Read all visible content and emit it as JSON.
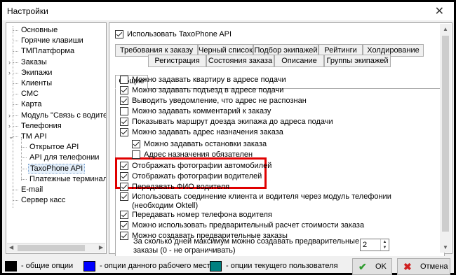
{
  "window": {
    "title": "Настройки",
    "close_glyph": "✕"
  },
  "tree": [
    {
      "label": "Основные",
      "level": 0,
      "expander": "",
      "selected": false
    },
    {
      "label": "Горячие клавиши",
      "level": 0,
      "expander": "",
      "selected": false
    },
    {
      "label": "ТМПлатформа",
      "level": 0,
      "expander": "",
      "selected": false
    },
    {
      "label": "Заказы",
      "level": 0,
      "expander": "›",
      "selected": false
    },
    {
      "label": "Экипажи",
      "level": 0,
      "expander": "›",
      "selected": false
    },
    {
      "label": "Клиенты",
      "level": 0,
      "expander": "",
      "selected": false
    },
    {
      "label": "СМС",
      "level": 0,
      "expander": "",
      "selected": false
    },
    {
      "label": "Карта",
      "level": 0,
      "expander": "",
      "selected": false
    },
    {
      "label": "Модуль \"Связь с водителе",
      "level": 0,
      "expander": "›",
      "selected": false
    },
    {
      "label": "Телефония",
      "level": 0,
      "expander": "›",
      "selected": false
    },
    {
      "label": "ТМ API",
      "level": 0,
      "expander": "⌄",
      "selected": false
    },
    {
      "label": "Открытое API",
      "level": 1,
      "expander": "",
      "selected": false
    },
    {
      "label": "API для телефонии",
      "level": 1,
      "expander": "",
      "selected": false
    },
    {
      "label": "TaxoPhone API",
      "level": 1,
      "expander": "",
      "selected": true
    },
    {
      "label": "Платежные терминалы",
      "level": 1,
      "expander": "",
      "selected": false
    },
    {
      "label": "E-mail",
      "level": 0,
      "expander": "",
      "selected": false
    },
    {
      "label": "Сервер касс",
      "level": 0,
      "expander": "",
      "selected": false
    }
  ],
  "use_api": {
    "label": "Использовать TaxoPhone API",
    "checked": true
  },
  "tabs_row1": [
    "Требования к заказу",
    "Черный список",
    "Подбор экипажей",
    "Рейтинги",
    "Холдирование"
  ],
  "tabs_row2": [
    "Общие",
    "Регистрация",
    "Состояния заказа",
    "Описание",
    "Группы экипажей"
  ],
  "active_tab": "Общие",
  "options": [
    {
      "label": "Можно задавать квартиру в адресе подачи",
      "checked": false,
      "indent": 0
    },
    {
      "label": "Можно задавать подъезд в адресе подачи",
      "checked": true,
      "indent": 0
    },
    {
      "label": "Выводить уведомление, что адрес не распознан",
      "checked": true,
      "indent": 0
    },
    {
      "label": "Можно задавать комментарий к заказу",
      "checked": false,
      "indent": 0
    },
    {
      "label": "Показывать маршрут доезда экипажа до адреса подачи",
      "checked": true,
      "indent": 0
    },
    {
      "label": "Можно задавать адрес назначения заказа",
      "checked": true,
      "indent": 0
    },
    {
      "label": "Можно задавать остановки заказа",
      "checked": true,
      "indent": 1
    },
    {
      "label": "Адрес назначения обязателен",
      "checked": false,
      "indent": 1
    },
    {
      "label": "Отображать фотографии автомобилей",
      "checked": true,
      "indent": 0
    },
    {
      "label": "Отображать фотографии водителей",
      "checked": true,
      "indent": 0
    },
    {
      "label": "Передавать ФИО водителя",
      "checked": true,
      "indent": 0
    },
    {
      "label": "Использовать соединение клиента и водителя через модуль телефонии",
      "label2": "(необходим Oktell)",
      "checked": true,
      "indent": 0
    },
    {
      "label": "Передавать номер телефона водителя",
      "checked": true,
      "indent": 0
    },
    {
      "label": "Можно использовать предварительный расчет стоимости заказа",
      "checked": true,
      "indent": 0
    },
    {
      "label": "Можно создавать предварительные заказы",
      "checked": true,
      "indent": 0
    }
  ],
  "days_question": {
    "line1": "За сколько дней максимум можно создавать предварительные",
    "line2": "заказы (0 - не ограничивать)",
    "value": "2"
  },
  "legend": [
    {
      "color": "#000000",
      "label": "- общие опции"
    },
    {
      "color": "#0000ff",
      "label": "- опции данного рабочего места"
    },
    {
      "color": "#008080",
      "label": "- опции текущего пользователя"
    }
  ],
  "buttons": {
    "ok": "OK",
    "cancel": "Отмена",
    "ok_icon_color": "#2e9b2e",
    "cancel_icon_color": "#d02020"
  },
  "colors": {
    "highlight": "#e00000"
  }
}
